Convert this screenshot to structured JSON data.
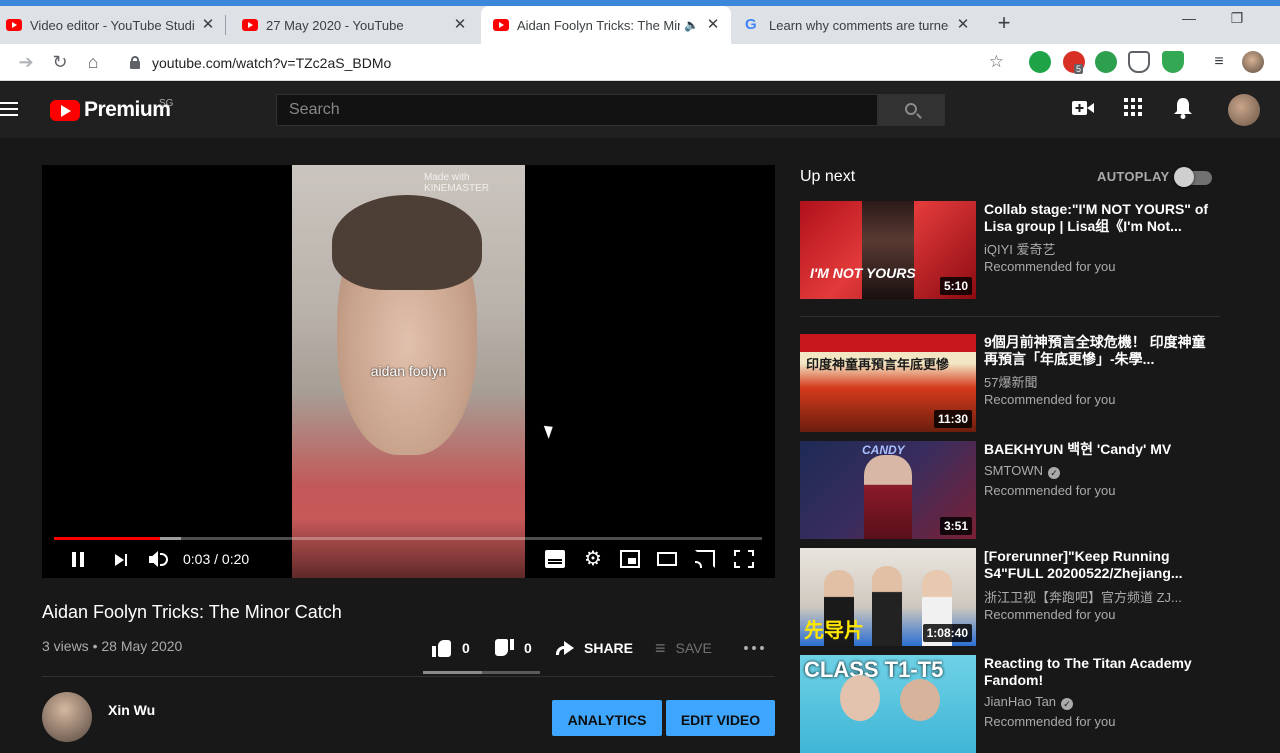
{
  "browser": {
    "tabs": [
      {
        "title": "Video editor - YouTube Studio",
        "active": false
      },
      {
        "title": "27 May 2020 - YouTube",
        "active": false
      },
      {
        "title": "Aidan Foolyn Tricks: The Minor",
        "active": true
      },
      {
        "title": "Learn why comments are turned",
        "active": false
      }
    ],
    "close_glyph": "✕",
    "new_tab_glyph": "+",
    "url": "youtube.com/watch?v=TZc2aS_BDMo",
    "adblock_badge": "5"
  },
  "masthead": {
    "logo_text": "Premium",
    "region": "SG",
    "search_placeholder": "Search"
  },
  "player": {
    "watermark": "Made with KINEMASTER",
    "caption": "aidan foolyn",
    "timecode": "0:03 / 0:20",
    "progress_fraction": 0.15,
    "buffer_fraction": 0.18
  },
  "video": {
    "title": "Aidan Foolyn Tricks: The Minor Catch",
    "meta": "3 views • 28 May 2020",
    "likes": "0",
    "dislikes": "0",
    "share_label": "SHARE",
    "save_label": "SAVE",
    "like_fraction": 0.5,
    "channel_name": "Xin Wu",
    "analytics_label": "ANALYTICS",
    "edit_label": "EDIT VIDEO"
  },
  "upnext": {
    "title": "Up next",
    "autoplay_label": "AUTOPLAY",
    "items": [
      {
        "title": "Collab stage:\"I'M NOT YOURS\" of Lisa group | Lisa组《I'm Not...",
        "channel": "iQIYI 爱奇艺",
        "verified": false,
        "reason": "Recommended for you",
        "duration": "5:10",
        "thumb_text": "I'M NOT YOURS"
      },
      {
        "title": "9個月前神預言全球危機！ 印度神童再預言「年底更慘」-朱學...",
        "channel": "57爆新聞",
        "verified": false,
        "reason": "Recommended for you",
        "duration": "11:30",
        "thumb_text": "印度神童再預言年底更慘"
      },
      {
        "title": "BAEKHYUN 백현 'Candy' MV",
        "channel": "SMTOWN",
        "verified": true,
        "reason": "Recommended for you",
        "duration": "3:51",
        "thumb_text": "CANDY"
      },
      {
        "title": "[Forerunner]\"Keep Running S4\"FULL 20200522/Zhejiang...",
        "channel": "浙江卫视【奔跑吧】官方频道 ZJ...",
        "verified": false,
        "reason": "Recommended for you",
        "duration": "1:08:40",
        "thumb_text": "先导片"
      },
      {
        "title": "Reacting to The Titan Academy Fandom!",
        "channel": "JianHao Tan",
        "verified": true,
        "reason": "Recommended for you",
        "duration": "",
        "thumb_text": "CLASS T1-T5"
      }
    ]
  },
  "colors": {
    "accent_red": "#ff0000",
    "cta_blue": "#3ea6ff",
    "background": "#181818"
  }
}
